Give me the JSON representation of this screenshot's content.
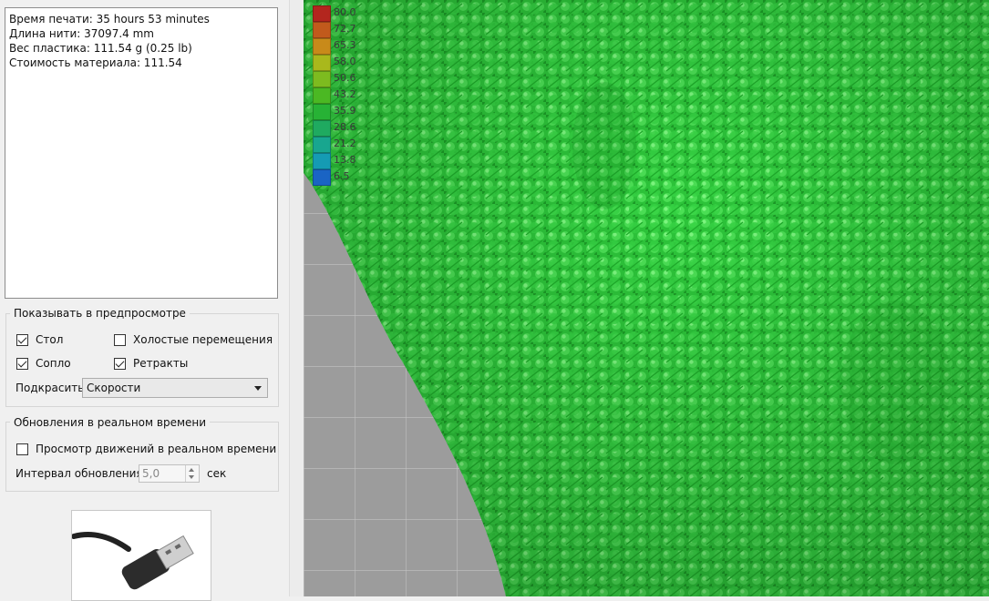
{
  "info": {
    "print_time": "Время печати: 35 hours 53 minutes",
    "filament_length": "Длина нити: 37097.4 mm",
    "plastic_weight": "Вес пластика: 111.54 g (0.25 lb)",
    "material_cost": "Стоимость материала: 111.54"
  },
  "preview_group": {
    "title": "Показывать в предпросмотре",
    "bed_label": "Стол",
    "bed_checked": true,
    "travel_label": "Холостые перемещения",
    "travel_checked": false,
    "nozzle_label": "Сопло",
    "nozzle_checked": true,
    "retracts_label": "Ретракты",
    "retracts_checked": true,
    "color_label": "Подкрасить",
    "color_value": "Скорости"
  },
  "realtime_group": {
    "title": "Обновления в реальном времени",
    "live_label": "Просмотр движений в реальном времени",
    "live_checked": false,
    "interval_label": "Интервал обновления",
    "interval_value": "5,0",
    "interval_unit": "сек"
  },
  "legend": [
    {
      "value": "80.0",
      "color": "#b3261e"
    },
    {
      "value": "72.7",
      "color": "#c15a1c"
    },
    {
      "value": "65.3",
      "color": "#c88a1a"
    },
    {
      "value": "58.0",
      "color": "#a9b81c"
    },
    {
      "value": "50.6",
      "color": "#7dbb1f"
    },
    {
      "value": "43.2",
      "color": "#4bb823"
    },
    {
      "value": "35.9",
      "color": "#27b235"
    },
    {
      "value": "28.6",
      "color": "#1faa60"
    },
    {
      "value": "21.2",
      "color": "#18a68f"
    },
    {
      "value": "13.8",
      "color": "#159bb3"
    },
    {
      "value": "6.5",
      "color": "#1a64c4"
    }
  ],
  "icons": {
    "thumbnail": "usb-cable-image"
  }
}
